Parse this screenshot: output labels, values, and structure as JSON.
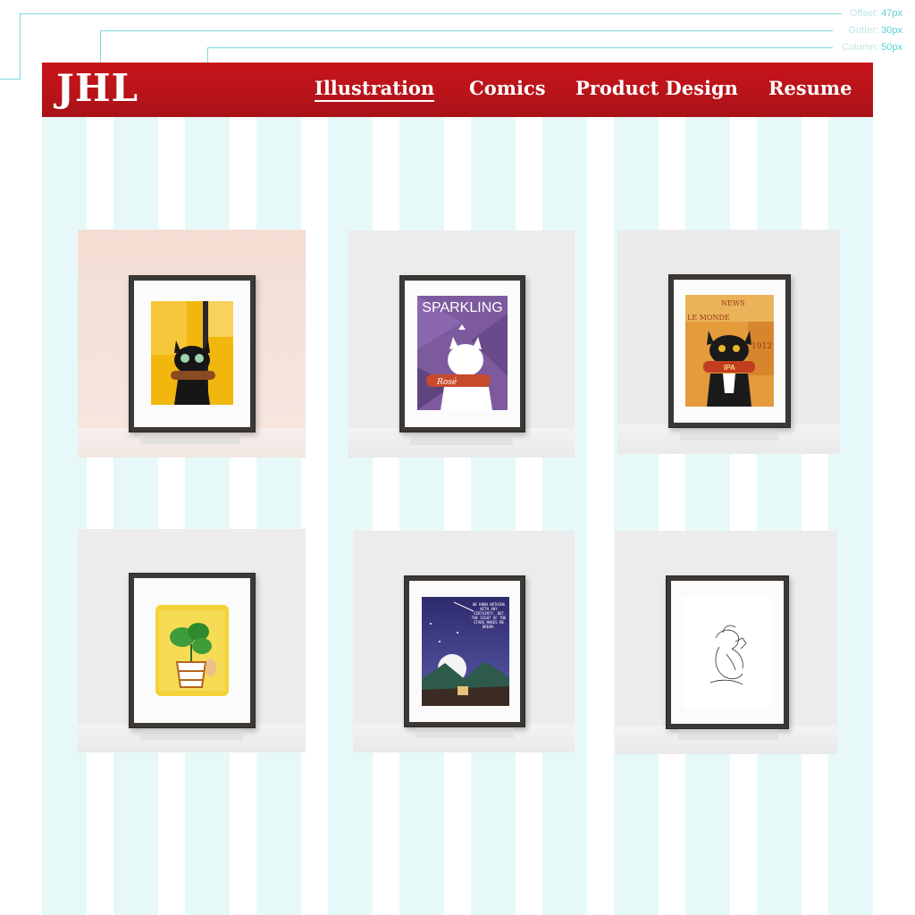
{
  "annotations": {
    "offset": {
      "label": "Offset:",
      "value": "47px"
    },
    "gutter": {
      "label": "Gutter:",
      "value": "30px"
    },
    "column": {
      "label": "Column:",
      "value": "50px"
    }
  },
  "header": {
    "logo": "JHL",
    "nav": [
      {
        "label": "Illustration",
        "active": true
      },
      {
        "label": "Comics",
        "active": false
      },
      {
        "label": "Product Design",
        "active": false
      },
      {
        "label": "Resume",
        "active": false
      }
    ]
  },
  "gallery": {
    "items": [
      {
        "name": "black-cat-rose-bottle-print",
        "artwork_text": ""
      },
      {
        "name": "white-cat-sparkling-print",
        "artwork_text": "SPARKLING",
        "bottle_text": "Rosé"
      },
      {
        "name": "black-cat-ipa-print",
        "artwork_text": "IPA",
        "collage_texts": [
          "LE MONDE",
          "1912",
          "NEWS"
        ]
      },
      {
        "name": "monstera-plant-cat-print",
        "artwork_text": ""
      },
      {
        "name": "stars-night-sky-print",
        "artwork_text": "WE KNOW NOTHING WITH ANY CERTAINTY, BUT THE SIGHT OF THE STARS MAKES ME DREAM."
      },
      {
        "name": "line-drawing-figure-print",
        "artwork_text": ""
      }
    ]
  },
  "colors": {
    "brand_red": "#c0141a",
    "grid_column": "#e6f9f8",
    "annotation": "#5ccfd0"
  }
}
